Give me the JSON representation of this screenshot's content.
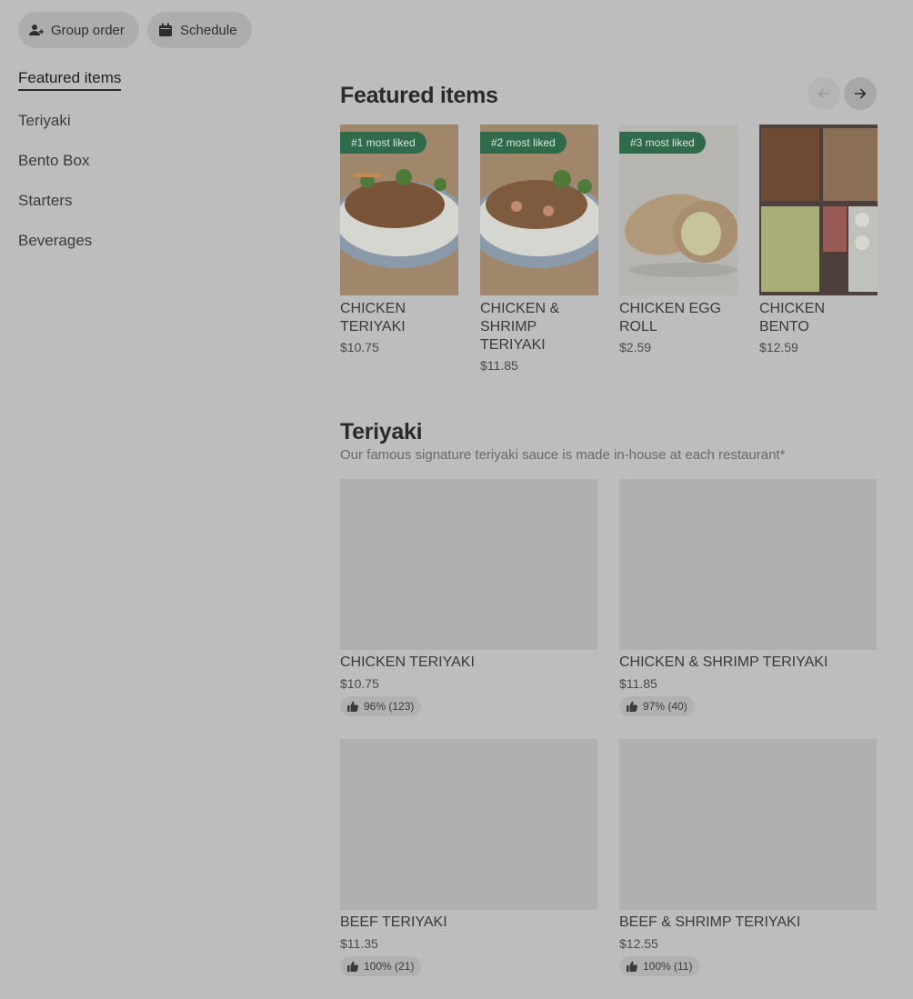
{
  "top_actions": {
    "group_order_label": "Group order",
    "schedule_label": "Schedule"
  },
  "sidebar": {
    "items": [
      {
        "label": "Featured items"
      },
      {
        "label": "Teriyaki"
      },
      {
        "label": "Bento Box"
      },
      {
        "label": "Starters"
      },
      {
        "label": "Beverages"
      }
    ]
  },
  "featured": {
    "title": "Featured items",
    "items": [
      {
        "badge": "#1 most liked",
        "name": "CHICKEN TERIYAKI",
        "price": "$10.75"
      },
      {
        "badge": "#2 most liked",
        "name": "CHICKEN & SHRIMP TERIYAKI",
        "price": "$11.85"
      },
      {
        "badge": "#3 most liked",
        "name": "CHICKEN EGG ROLL",
        "price": "$2.59"
      },
      {
        "badge": "",
        "name": "CHICKEN BENTO",
        "price": "$12.59"
      }
    ]
  },
  "teriyaki": {
    "title": "Teriyaki",
    "subtitle": "Our famous signature teriyaki sauce is made in-house at each restaurant*",
    "items": [
      {
        "name": "CHICKEN TERIYAKI",
        "price": "$10.75",
        "rating": "96% (123)"
      },
      {
        "name": "CHICKEN & SHRIMP TERIYAKI",
        "price": "$11.85",
        "rating": "97% (40)"
      },
      {
        "name": "BEEF TERIYAKI",
        "price": "$11.35",
        "rating": "100% (21)"
      },
      {
        "name": "BEEF & SHRIMP TERIYAKI",
        "price": "$12.55",
        "rating": "100% (11)"
      }
    ]
  },
  "colors": {
    "overlay_background": "#bdbdbd",
    "badge_green": "#2f6b4a"
  }
}
